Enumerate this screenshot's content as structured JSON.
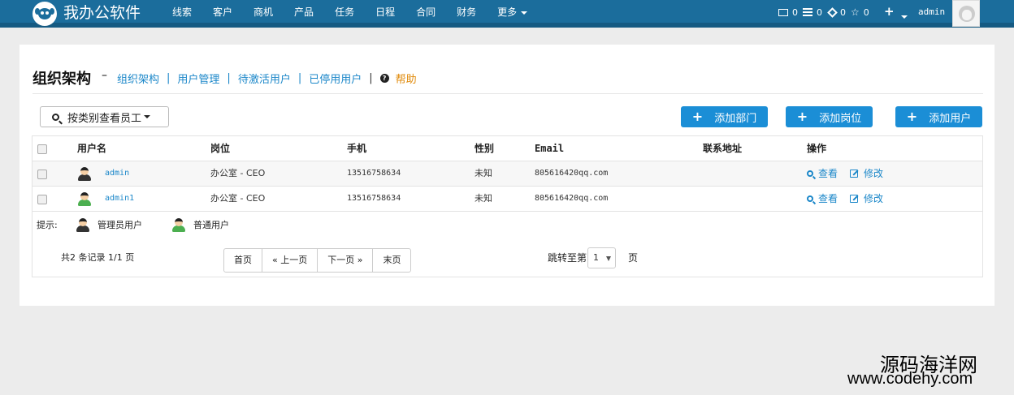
{
  "brand": {
    "name": "我办公软件"
  },
  "nav": {
    "items": [
      "线索",
      "客户",
      "商机",
      "产品",
      "任务",
      "日程",
      "合同",
      "财务"
    ],
    "more": "更多"
  },
  "header_right": {
    "mail_count": "0",
    "list_count": "0",
    "diamond_count": "0",
    "star_count": "0",
    "user": "admin"
  },
  "page": {
    "title": "组织架构",
    "dash": "–",
    "crumbs": [
      "组织架构",
      "用户管理",
      "待激活用户",
      "已停用用户"
    ],
    "help": "帮助"
  },
  "toolbar": {
    "filter": "按类别查看员工",
    "add_department": "添加部门",
    "add_position": "添加岗位",
    "add_user": "添加用户"
  },
  "table": {
    "headers": [
      "用户名",
      "岗位",
      "手机",
      "性别",
      "Email",
      "联系地址",
      "操作"
    ],
    "rows": [
      {
        "username": "admin",
        "position": "办公室 - CEO",
        "phone": "13516758634",
        "gender": "未知",
        "email": "805616420qq.com",
        "address": "",
        "view": "查看",
        "edit": "修改",
        "role": "admin"
      },
      {
        "username": "admin1",
        "position": "办公室 - CEO",
        "phone": "13516758634",
        "gender": "未知",
        "email": "805616420qq.com",
        "address": "",
        "view": "查看",
        "edit": "修改",
        "role": "normal"
      }
    ]
  },
  "legend": {
    "label": "提示:",
    "admin": "管理员用户",
    "normal": "普通用户"
  },
  "pagination": {
    "summary": "共2 条记录 1/1 页",
    "first": "首页",
    "prev": "« 上一页",
    "next": "下一页 »",
    "last": "末页",
    "jump_label": "跳转至第",
    "jump_value": "1",
    "jump_unit": "页"
  },
  "watermark": {
    "line1": "源码海洋网",
    "line2": "www.codehy.com"
  },
  "colors": {
    "nav_bg": "#1b6d9c",
    "accent": "#1b8ed6",
    "link": "#1b87c9",
    "help": "#e08a0a",
    "admin_body": "#333333",
    "normal_body": "#4caf50"
  }
}
